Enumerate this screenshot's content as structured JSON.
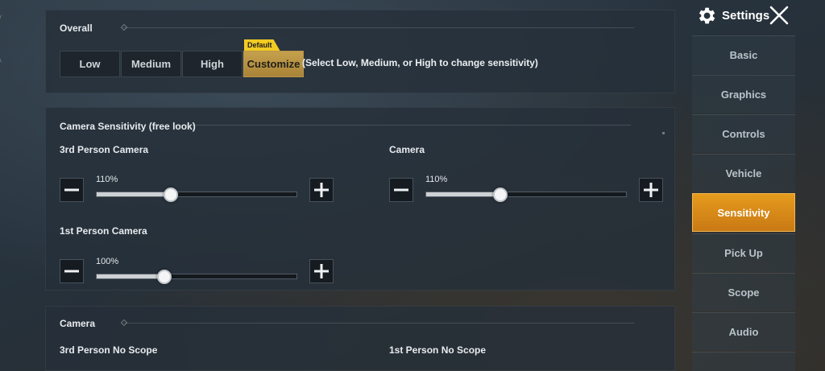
{
  "overall": {
    "title": "Overall",
    "presets": [
      "Low",
      "Medium",
      "High",
      "Customize"
    ],
    "active_preset": "Customize",
    "default_tag": "Default",
    "hint": "(Select Low, Medium, or High to change sensitivity)"
  },
  "camera_sensitivity": {
    "title": "Camera Sensitivity (free look)",
    "third_person": {
      "label": "3rd Person Camera",
      "value_text": "110%",
      "value": 110
    },
    "camera": {
      "label": "Camera",
      "value_text": "110%",
      "value": 110
    },
    "first_person": {
      "label": "1st Person Camera",
      "value_text": "100%",
      "value": 100
    }
  },
  "camera_section": {
    "title": "Camera",
    "third_person_no_scope": "3rd Person No Scope",
    "first_person_no_scope": "1st Person No Scope"
  },
  "sidebar": {
    "title": "Settings",
    "items": [
      "Basic",
      "Graphics",
      "Controls",
      "Vehicle",
      "Sensitivity",
      "Pick Up",
      "Scope",
      "Audio"
    ],
    "active": "Sensitivity",
    "accent_color": "#E59B1D"
  },
  "colors": {
    "preset_active": "#C5A04C",
    "default_tag": "#F2CB23"
  }
}
